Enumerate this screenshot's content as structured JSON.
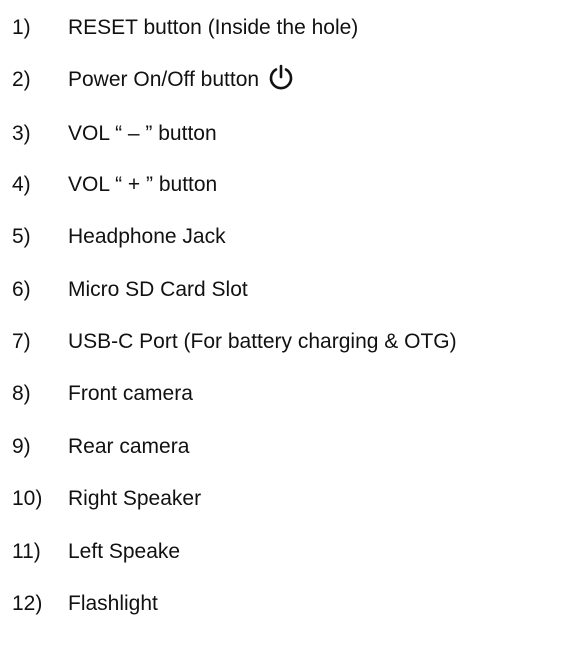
{
  "items": [
    {
      "num": "1)",
      "text": "RESET button (Inside the hole)"
    },
    {
      "num": "2)",
      "text": "Power On/Off button",
      "icon": "power-icon"
    },
    {
      "num": "3)",
      "text": "VOL  “ – ” button"
    },
    {
      "num": "4)",
      "text": "VOL  “ + ” button"
    },
    {
      "num": "5)",
      "text": "Headphone Jack"
    },
    {
      "num": "6)",
      "text": "Micro SD Card Slot"
    },
    {
      "num": "7)",
      "text": "USB-C Port (For battery charging & OTG)"
    },
    {
      "num": "8)",
      "text": "Front camera"
    },
    {
      "num": "9)",
      "text": "Rear camera"
    },
    {
      "num": "10)",
      "text": "Right Speaker"
    },
    {
      "num": "11)",
      "text": "Left Speake"
    },
    {
      "num": "12)",
      "text": "Flashlight"
    }
  ]
}
